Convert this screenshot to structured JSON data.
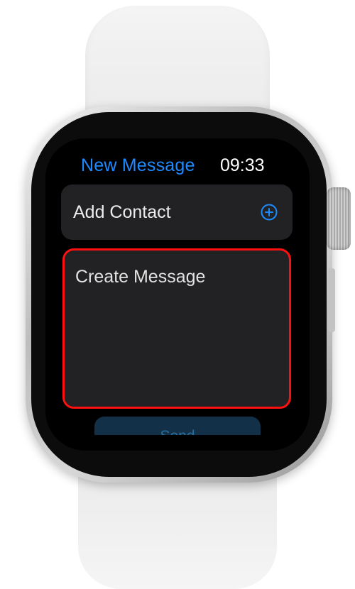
{
  "header": {
    "title": "New Message",
    "time": "09:33"
  },
  "contact": {
    "label": "Add Contact",
    "icon": "plus-circle-icon"
  },
  "message": {
    "placeholder": "Create Message",
    "highlight_color": "#ff1010"
  },
  "send": {
    "label": "Send"
  },
  "colors": {
    "accent": "#1d8bff",
    "screen": "#000000",
    "row_background": "#222224",
    "send_background": "#123048"
  }
}
